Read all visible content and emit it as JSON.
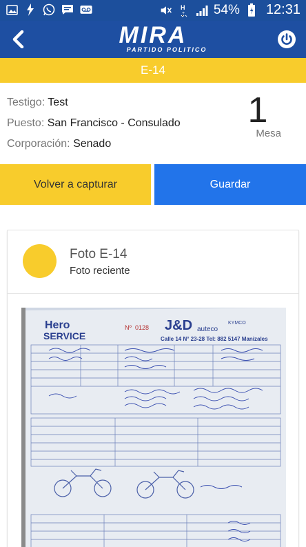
{
  "status_bar": {
    "icons": [
      "image-icon",
      "flash-icon",
      "whatsapp-icon",
      "message-icon",
      "voicemail-icon"
    ],
    "right_icons": [
      "mute-icon",
      "hplus-signal-icon",
      "signal-icon"
    ],
    "battery": "54%",
    "time": "12:31"
  },
  "header": {
    "logo_main": "MIRA",
    "logo_sub": "PARTIDO POLITICO"
  },
  "form_bar": {
    "title": "E-14"
  },
  "info": {
    "testigo_label": "Testigo:",
    "testigo_value": "Test",
    "puesto_label": "Puesto:",
    "puesto_value": "San Francisco - Consulado",
    "corporacion_label": "Corporación:",
    "corporacion_value": "Senado",
    "mesa_number": "1",
    "mesa_label": "Mesa"
  },
  "buttons": {
    "recapture": "Volver a capturar",
    "save": "Guardar"
  },
  "card": {
    "title": "Foto E-14",
    "subtitle": "Foto reciente"
  },
  "photo": {
    "brand": "Hero",
    "brand_sub": "SERVICE",
    "number": "0128",
    "dealer": "J&D",
    "dealer_sub": "auteco",
    "address": "Calle 14 N° 23-28 Tel: 882 5147 Manizales",
    "kymco": "KYMCO"
  },
  "colors": {
    "header_blue": "#1e4fa2",
    "status_blue": "#1c4f9c",
    "accent_yellow": "#f8cc2c",
    "save_blue": "#2274ea"
  }
}
